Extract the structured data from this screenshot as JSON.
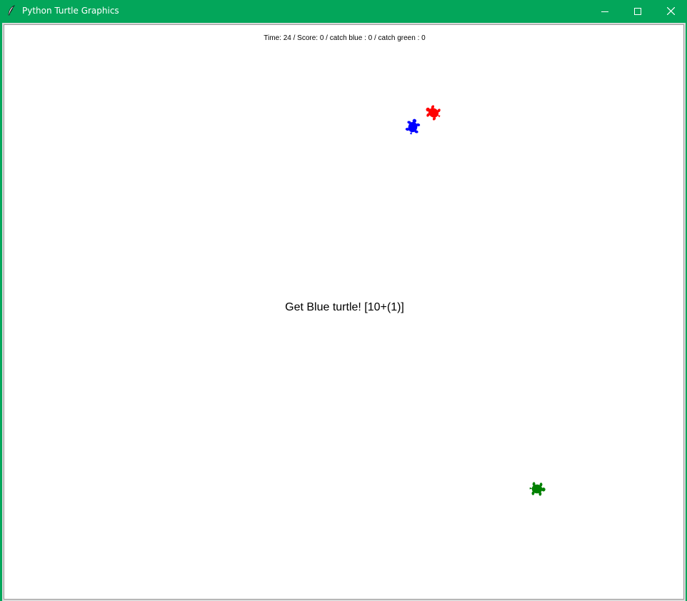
{
  "window": {
    "title": "Python Turtle Graphics",
    "icon": "feather-icon",
    "titlebar_color": "#03a65a",
    "buttons": {
      "minimize_icon": "minimize-icon",
      "maximize_icon": "maximize-icon",
      "close_icon": "close-icon"
    }
  },
  "game": {
    "status": "Time: 24 / Score: 0 / catch blue : 0 / catch green : 0",
    "message": "Get Blue turtle!  [10+(1)]",
    "turtles": {
      "red": {
        "color": "#ff0000"
      },
      "blue": {
        "color": "#0000ff"
      },
      "green": {
        "color": "#008000"
      }
    }
  }
}
